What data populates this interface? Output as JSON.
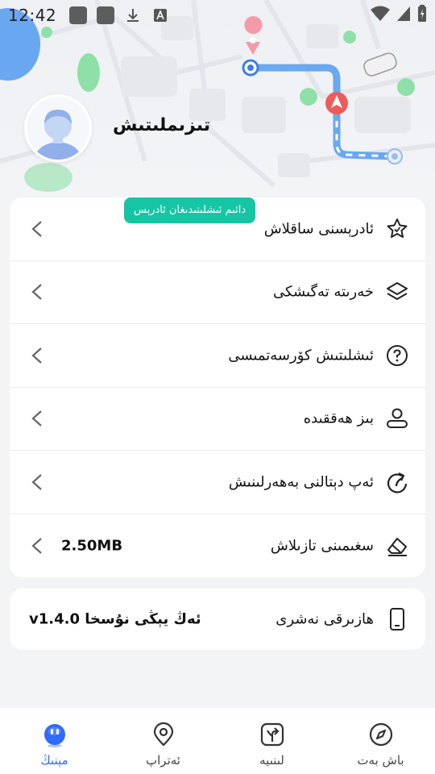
{
  "status_bar": {
    "time": "12:42",
    "icons": [
      "app-icon",
      "app-icon",
      "download-icon",
      "a-icon",
      "wifi-icon",
      "signal-icon",
      "battery-icon"
    ]
  },
  "profile": {
    "name": "تىزىملىتىش"
  },
  "menu": {
    "items": [
      {
        "key": "saved-addresses",
        "label": "ئادرېسنى ساقلاش",
        "badge": "دائىم ئىشلىتىدىغان ئادرېس",
        "icon": "star-icon"
      },
      {
        "key": "map-change",
        "label": "خەرىتە تەگىشكى",
        "icon": "layers-icon"
      },
      {
        "key": "help",
        "label": "ئىشلىتىش كۆرسەتمىسى",
        "icon": "question-icon"
      },
      {
        "key": "about",
        "label": "بىز ھەققىدە",
        "icon": "user-icon"
      },
      {
        "key": "app-rating",
        "label": "ئەپ دېتالنى بەھەرلىنىش",
        "icon": "share-arrow-icon"
      },
      {
        "key": "clear-cache",
        "label": "سغىمىنى تازىلاش",
        "value": "2.50MB",
        "icon": "eraser-icon"
      }
    ]
  },
  "version": {
    "label": "ھازىرقى نەشرى",
    "value": "v1.4.0 ئەڭ يېڭى نۇسخا",
    "icon": "phone-icon"
  },
  "bottom_nav": {
    "items": [
      {
        "key": "mine",
        "label": "مېنىڭ",
        "icon": "bot-face-icon",
        "active": true
      },
      {
        "key": "around",
        "label": "ئەتراپ",
        "icon": "location-pin-icon",
        "active": false
      },
      {
        "key": "line",
        "label": "لىنىيە",
        "icon": "route-sign-icon",
        "active": false
      },
      {
        "key": "home",
        "label": "باش بەت",
        "icon": "compass-icon",
        "active": false
      }
    ]
  },
  "colors": {
    "accent": "#2f6bff",
    "badge": "#16c5a4",
    "route": "#6aa8f0",
    "green_dots": "#7fdc9a",
    "background": "#f3f4f6"
  }
}
